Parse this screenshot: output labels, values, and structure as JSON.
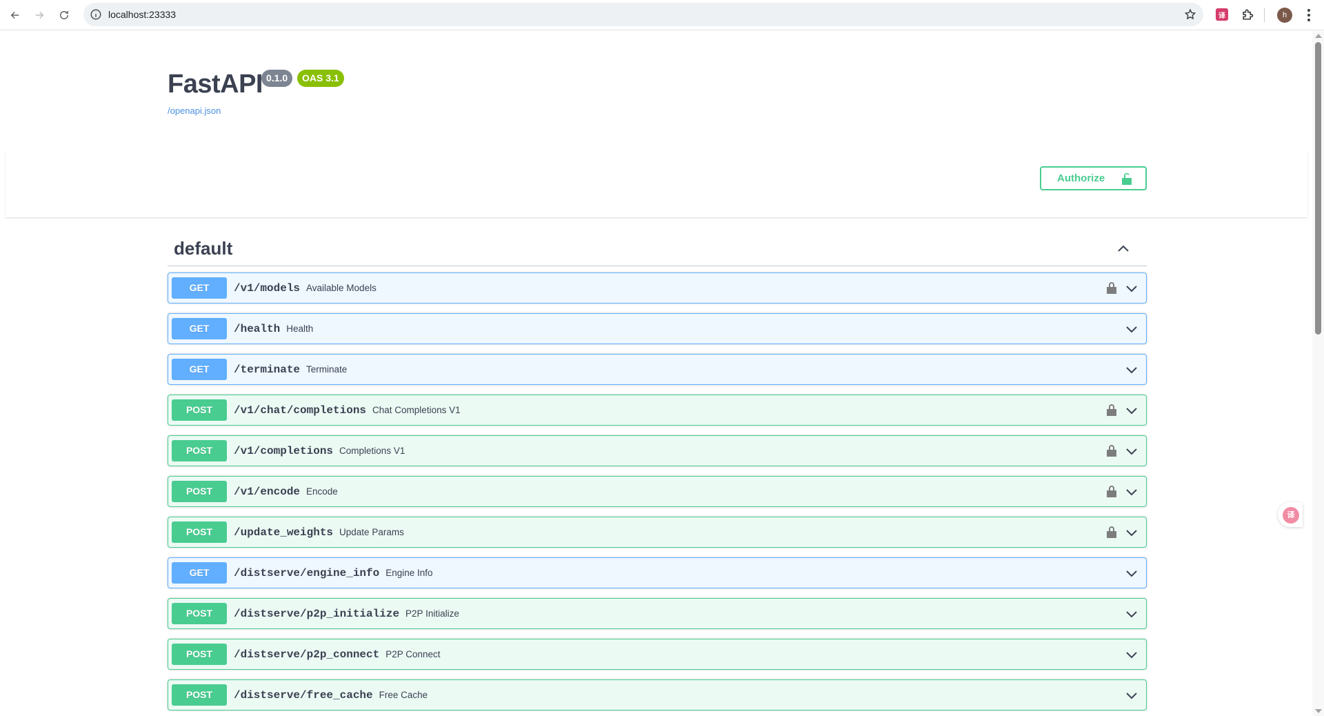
{
  "browser": {
    "url": "localhost:23333",
    "avatar_letter": "h",
    "translate_ext_label": "译"
  },
  "info": {
    "title": "FastAPI",
    "version": "0.1.0",
    "oas": "OAS 3.1",
    "spec_link": "/openapi.json"
  },
  "authorize": {
    "label": "Authorize"
  },
  "tag": {
    "name": "default"
  },
  "operations": [
    {
      "method": "GET",
      "path": "/v1/models",
      "summary": "Available Models",
      "locked": true
    },
    {
      "method": "GET",
      "path": "/health",
      "summary": "Health",
      "locked": false
    },
    {
      "method": "GET",
      "path": "/terminate",
      "summary": "Terminate",
      "locked": false
    },
    {
      "method": "POST",
      "path": "/v1/chat/completions",
      "summary": "Chat Completions V1",
      "locked": true
    },
    {
      "method": "POST",
      "path": "/v1/completions",
      "summary": "Completions V1",
      "locked": true
    },
    {
      "method": "POST",
      "path": "/v1/encode",
      "summary": "Encode",
      "locked": true
    },
    {
      "method": "POST",
      "path": "/update_weights",
      "summary": "Update Params",
      "locked": true
    },
    {
      "method": "GET",
      "path": "/distserve/engine_info",
      "summary": "Engine Info",
      "locked": false
    },
    {
      "method": "POST",
      "path": "/distserve/p2p_initialize",
      "summary": "P2P Initialize",
      "locked": false
    },
    {
      "method": "POST",
      "path": "/distserve/p2p_connect",
      "summary": "P2P Connect",
      "locked": false
    },
    {
      "method": "POST",
      "path": "/distserve/free_cache",
      "summary": "Free Cache",
      "locked": false
    }
  ],
  "colors": {
    "get": "#61affe",
    "post": "#49cc90",
    "authorize": "#49cc90",
    "version_badge": "#7d8492",
    "oas_badge": "#89bf04"
  }
}
